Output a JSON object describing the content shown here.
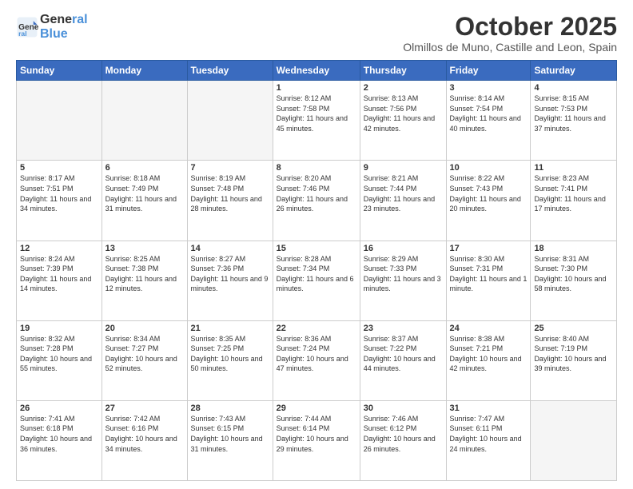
{
  "logo": {
    "line1": "General",
    "line2": "Blue"
  },
  "title": "October 2025",
  "subtitle": "Olmillos de Muno, Castille and Leon, Spain",
  "headers": [
    "Sunday",
    "Monday",
    "Tuesday",
    "Wednesday",
    "Thursday",
    "Friday",
    "Saturday"
  ],
  "weeks": [
    [
      {
        "day": "",
        "sunrise": "",
        "sunset": "",
        "daylight": ""
      },
      {
        "day": "",
        "sunrise": "",
        "sunset": "",
        "daylight": ""
      },
      {
        "day": "",
        "sunrise": "",
        "sunset": "",
        "daylight": ""
      },
      {
        "day": "1",
        "sunrise": "Sunrise: 8:12 AM",
        "sunset": "Sunset: 7:58 PM",
        "daylight": "Daylight: 11 hours and 45 minutes."
      },
      {
        "day": "2",
        "sunrise": "Sunrise: 8:13 AM",
        "sunset": "Sunset: 7:56 PM",
        "daylight": "Daylight: 11 hours and 42 minutes."
      },
      {
        "day": "3",
        "sunrise": "Sunrise: 8:14 AM",
        "sunset": "Sunset: 7:54 PM",
        "daylight": "Daylight: 11 hours and 40 minutes."
      },
      {
        "day": "4",
        "sunrise": "Sunrise: 8:15 AM",
        "sunset": "Sunset: 7:53 PM",
        "daylight": "Daylight: 11 hours and 37 minutes."
      }
    ],
    [
      {
        "day": "5",
        "sunrise": "Sunrise: 8:17 AM",
        "sunset": "Sunset: 7:51 PM",
        "daylight": "Daylight: 11 hours and 34 minutes."
      },
      {
        "day": "6",
        "sunrise": "Sunrise: 8:18 AM",
        "sunset": "Sunset: 7:49 PM",
        "daylight": "Daylight: 11 hours and 31 minutes."
      },
      {
        "day": "7",
        "sunrise": "Sunrise: 8:19 AM",
        "sunset": "Sunset: 7:48 PM",
        "daylight": "Daylight: 11 hours and 28 minutes."
      },
      {
        "day": "8",
        "sunrise": "Sunrise: 8:20 AM",
        "sunset": "Sunset: 7:46 PM",
        "daylight": "Daylight: 11 hours and 26 minutes."
      },
      {
        "day": "9",
        "sunrise": "Sunrise: 8:21 AM",
        "sunset": "Sunset: 7:44 PM",
        "daylight": "Daylight: 11 hours and 23 minutes."
      },
      {
        "day": "10",
        "sunrise": "Sunrise: 8:22 AM",
        "sunset": "Sunset: 7:43 PM",
        "daylight": "Daylight: 11 hours and 20 minutes."
      },
      {
        "day": "11",
        "sunrise": "Sunrise: 8:23 AM",
        "sunset": "Sunset: 7:41 PM",
        "daylight": "Daylight: 11 hours and 17 minutes."
      }
    ],
    [
      {
        "day": "12",
        "sunrise": "Sunrise: 8:24 AM",
        "sunset": "Sunset: 7:39 PM",
        "daylight": "Daylight: 11 hours and 14 minutes."
      },
      {
        "day": "13",
        "sunrise": "Sunrise: 8:25 AM",
        "sunset": "Sunset: 7:38 PM",
        "daylight": "Daylight: 11 hours and 12 minutes."
      },
      {
        "day": "14",
        "sunrise": "Sunrise: 8:27 AM",
        "sunset": "Sunset: 7:36 PM",
        "daylight": "Daylight: 11 hours and 9 minutes."
      },
      {
        "day": "15",
        "sunrise": "Sunrise: 8:28 AM",
        "sunset": "Sunset: 7:34 PM",
        "daylight": "Daylight: 11 hours and 6 minutes."
      },
      {
        "day": "16",
        "sunrise": "Sunrise: 8:29 AM",
        "sunset": "Sunset: 7:33 PM",
        "daylight": "Daylight: 11 hours and 3 minutes."
      },
      {
        "day": "17",
        "sunrise": "Sunrise: 8:30 AM",
        "sunset": "Sunset: 7:31 PM",
        "daylight": "Daylight: 11 hours and 1 minute."
      },
      {
        "day": "18",
        "sunrise": "Sunrise: 8:31 AM",
        "sunset": "Sunset: 7:30 PM",
        "daylight": "Daylight: 10 hours and 58 minutes."
      }
    ],
    [
      {
        "day": "19",
        "sunrise": "Sunrise: 8:32 AM",
        "sunset": "Sunset: 7:28 PM",
        "daylight": "Daylight: 10 hours and 55 minutes."
      },
      {
        "day": "20",
        "sunrise": "Sunrise: 8:34 AM",
        "sunset": "Sunset: 7:27 PM",
        "daylight": "Daylight: 10 hours and 52 minutes."
      },
      {
        "day": "21",
        "sunrise": "Sunrise: 8:35 AM",
        "sunset": "Sunset: 7:25 PM",
        "daylight": "Daylight: 10 hours and 50 minutes."
      },
      {
        "day": "22",
        "sunrise": "Sunrise: 8:36 AM",
        "sunset": "Sunset: 7:24 PM",
        "daylight": "Daylight: 10 hours and 47 minutes."
      },
      {
        "day": "23",
        "sunrise": "Sunrise: 8:37 AM",
        "sunset": "Sunset: 7:22 PM",
        "daylight": "Daylight: 10 hours and 44 minutes."
      },
      {
        "day": "24",
        "sunrise": "Sunrise: 8:38 AM",
        "sunset": "Sunset: 7:21 PM",
        "daylight": "Daylight: 10 hours and 42 minutes."
      },
      {
        "day": "25",
        "sunrise": "Sunrise: 8:40 AM",
        "sunset": "Sunset: 7:19 PM",
        "daylight": "Daylight: 10 hours and 39 minutes."
      }
    ],
    [
      {
        "day": "26",
        "sunrise": "Sunrise: 7:41 AM",
        "sunset": "Sunset: 6:18 PM",
        "daylight": "Daylight: 10 hours and 36 minutes."
      },
      {
        "day": "27",
        "sunrise": "Sunrise: 7:42 AM",
        "sunset": "Sunset: 6:16 PM",
        "daylight": "Daylight: 10 hours and 34 minutes."
      },
      {
        "day": "28",
        "sunrise": "Sunrise: 7:43 AM",
        "sunset": "Sunset: 6:15 PM",
        "daylight": "Daylight: 10 hours and 31 minutes."
      },
      {
        "day": "29",
        "sunrise": "Sunrise: 7:44 AM",
        "sunset": "Sunset: 6:14 PM",
        "daylight": "Daylight: 10 hours and 29 minutes."
      },
      {
        "day": "30",
        "sunrise": "Sunrise: 7:46 AM",
        "sunset": "Sunset: 6:12 PM",
        "daylight": "Daylight: 10 hours and 26 minutes."
      },
      {
        "day": "31",
        "sunrise": "Sunrise: 7:47 AM",
        "sunset": "Sunset: 6:11 PM",
        "daylight": "Daylight: 10 hours and 24 minutes."
      },
      {
        "day": "",
        "sunrise": "",
        "sunset": "",
        "daylight": ""
      }
    ]
  ]
}
